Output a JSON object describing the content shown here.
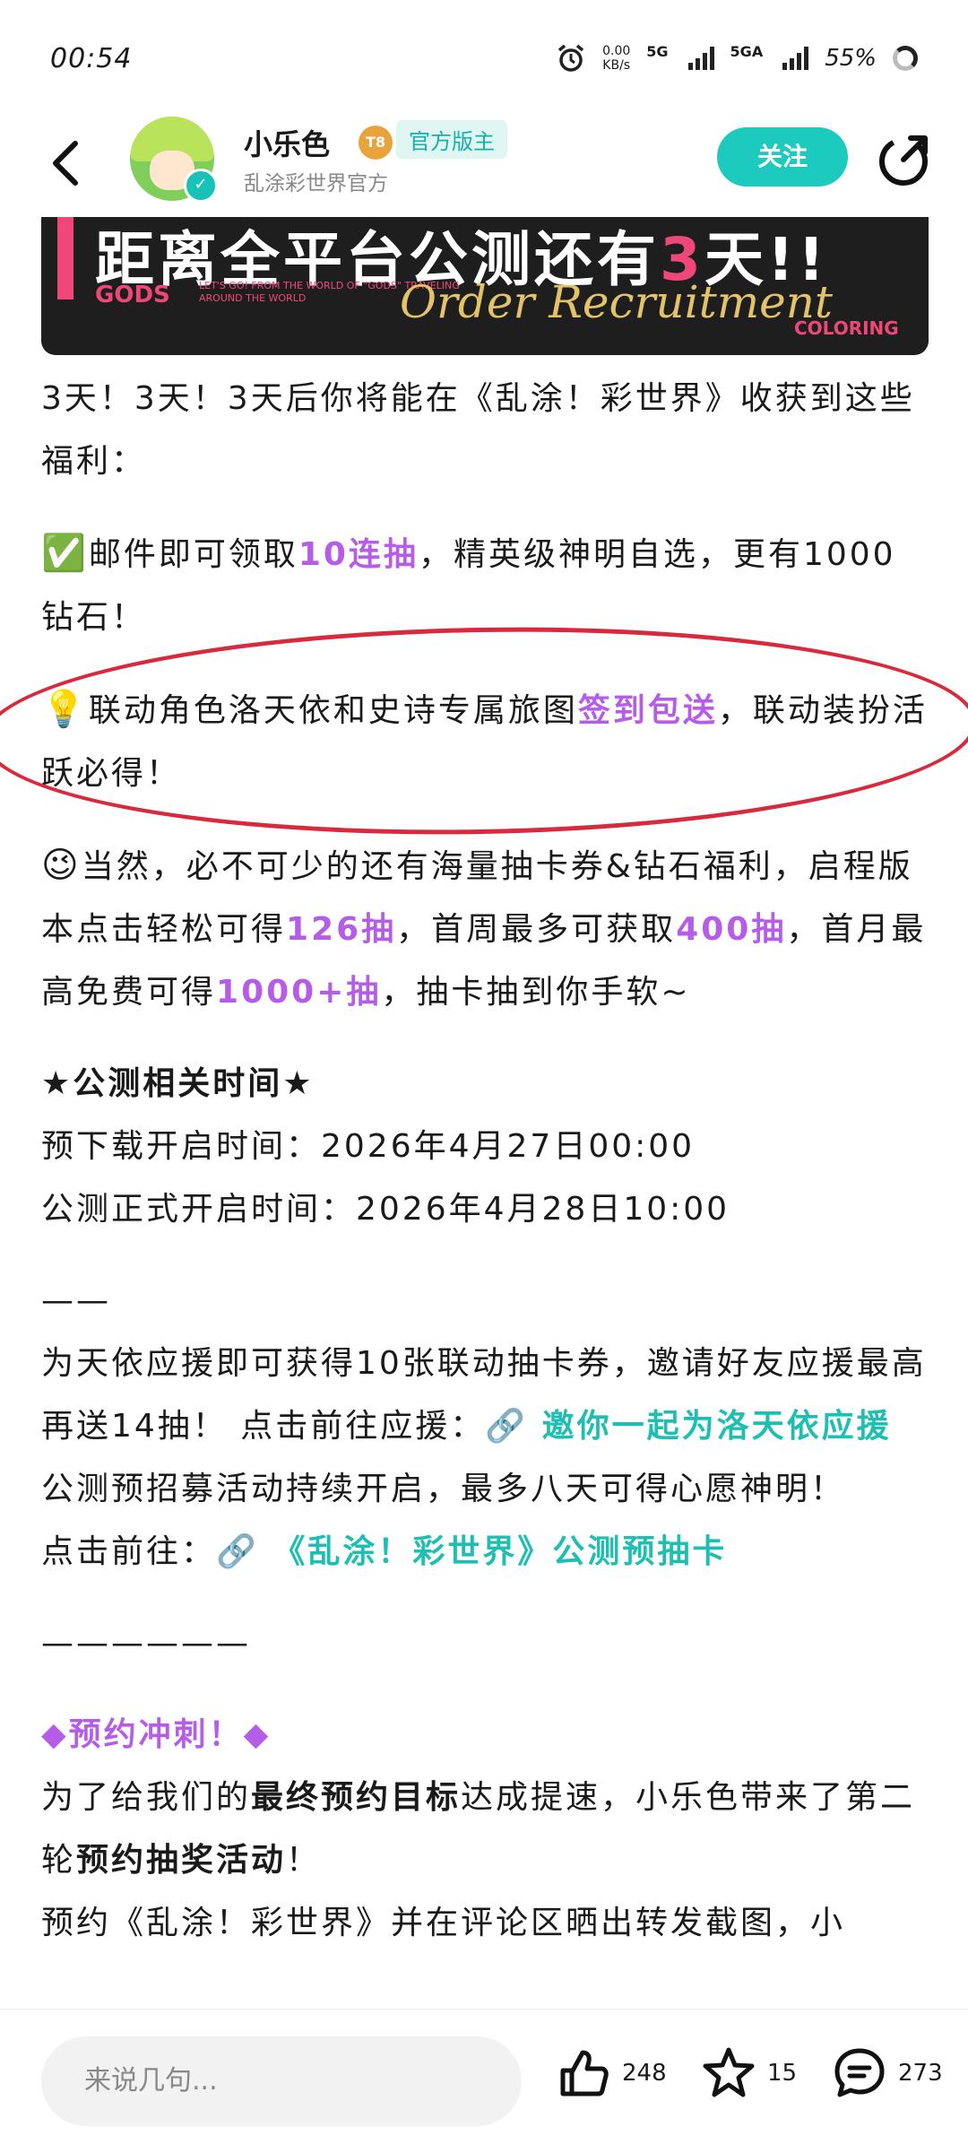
{
  "status": {
    "time": "00:54",
    "net_speed_value": "0.00",
    "net_speed_unit": "KB/s",
    "signal1": "5G",
    "signal2": "5GA",
    "battery": "55%"
  },
  "header": {
    "author_name": "小乐色",
    "level": "T8",
    "role_badge": "官方版主",
    "author_sub": "乱涂彩世界官方",
    "follow_label": "关注"
  },
  "banner": {
    "title_prefix": "距离全平台公测还有",
    "title_days": "3",
    "title_suffix": "天!!",
    "gods": "GODS",
    "small_text": "LET'S GO! FROM THE WORLD OF \"GODS\" TRAVELING AROUND THE WORLD",
    "script_text": "Order Recruitment",
    "coloring": "COLORING"
  },
  "post": {
    "p1": "3天！3天！3天后你将能在《乱涂！彩世界》收获到这些福利：",
    "p2_emoji": "✅",
    "p2_a": "邮件即可领取",
    "p2_hl": "10连抽",
    "p2_b": "，精英级神明自选，更有1000钻石！",
    "p3_emoji": "💡",
    "p3_a": "联动角色洛天依和史诗专属旅图",
    "p3_hl": "签到包送",
    "p3_b": "，联动装扮活跃必得！",
    "p4_emoji": "😉",
    "p4_a": "当然，必不可少的还有海量抽卡券&钻石福利，启程版本点击轻松可得",
    "p4_hl1": "126抽",
    "p4_b": "，首周最多可获取",
    "p4_hl2": "400抽",
    "p4_c": "，首月最高免费可得",
    "p4_hl3": "1000+抽",
    "p4_d": "，抽卡抽到你手软~",
    "section_title": "★公测相关时间★",
    "time1": "预下载开启时间：2026年4月27日00:00",
    "time2": "公测正式开启时间：2026年4月28日10:00",
    "divider1": "——",
    "p5_a": "为天依应援即可获得10张联动抽卡券，邀请好友应援最高再送14抽！ 点击前往应援：",
    "p5_link": "邀你一起为洛天依应援",
    "p6": "公测预招募活动持续开启，最多八天可得心愿神明！",
    "p7_a": "点击前往：",
    "p7_link": "《乱涂！彩世界》公测预抽卡",
    "divider2": "——————",
    "reserve_title": "◆预约冲刺！◆",
    "p8_a": "为了给我们的",
    "p8_bold": "最终预约目标",
    "p8_b": "达成提速，小乐色带来了第二轮",
    "p8_bold2": "预约抽奖活动",
    "p8_c": "！",
    "p9": "预约《乱涂！彩世界》并在评论区晒出转发截图，小"
  },
  "bottom": {
    "comment_placeholder": "来说几句...",
    "likes": "248",
    "favorites": "15",
    "comments": "273"
  }
}
